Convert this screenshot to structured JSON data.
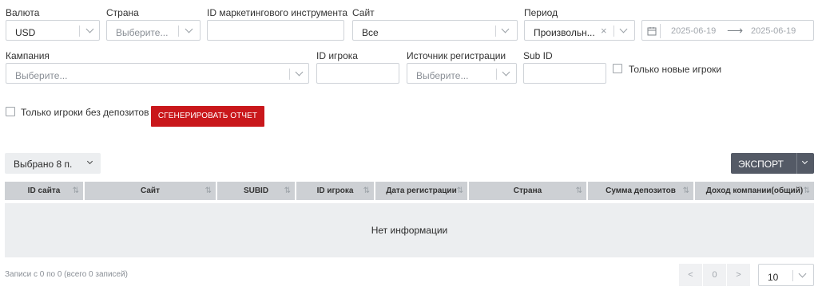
{
  "filters": {
    "currency": {
      "label": "Валюта",
      "value": "USD"
    },
    "country": {
      "label": "Страна",
      "placeholder": "Выберите..."
    },
    "marketing_id": {
      "label": "ID маркетингового инструмента",
      "value": ""
    },
    "site": {
      "label": "Сайт",
      "value": "Все"
    },
    "period": {
      "label": "Период",
      "value": "Произвольн...",
      "clear": "×",
      "date_from": "2025-06-19",
      "arrow": "⟶",
      "date_to": "2025-06-19"
    },
    "campaign": {
      "label": "Кампания",
      "placeholder": "Выберите..."
    },
    "player_id": {
      "label": "ID игрока",
      "value": ""
    },
    "reg_source": {
      "label": "Источник регистрации",
      "placeholder": "Выберите..."
    },
    "sub_id": {
      "label": "Sub ID",
      "value": ""
    },
    "only_new_players": {
      "label": "Только новые игроки",
      "checked": false
    },
    "only_no_deposit": {
      "label": "Только игроки без депозитов",
      "checked": false
    }
  },
  "actions": {
    "generate": "Сгенерировать отчет",
    "selected": "Выбрано 8 п.",
    "export": "ЭКСПОРТ"
  },
  "table": {
    "columns": [
      "ID сайта",
      "Сайт",
      "SUBID",
      "ID игрока",
      "Дата регистрации",
      "Страна",
      "Сумма депозитов",
      "Доход компании(общий)"
    ],
    "sort_glyph": "⇅",
    "empty": "Нет информации"
  },
  "footer": {
    "records": "Записи с 0 по 0 (всего 0 записей)",
    "prev": "<",
    "page": "0",
    "next": ">",
    "page_size": "10"
  },
  "colors": {
    "accent_red": "#c9171b",
    "export_bg": "#545a66",
    "header_bg": "#cdd0d4",
    "row_bg": "#eceef0"
  }
}
